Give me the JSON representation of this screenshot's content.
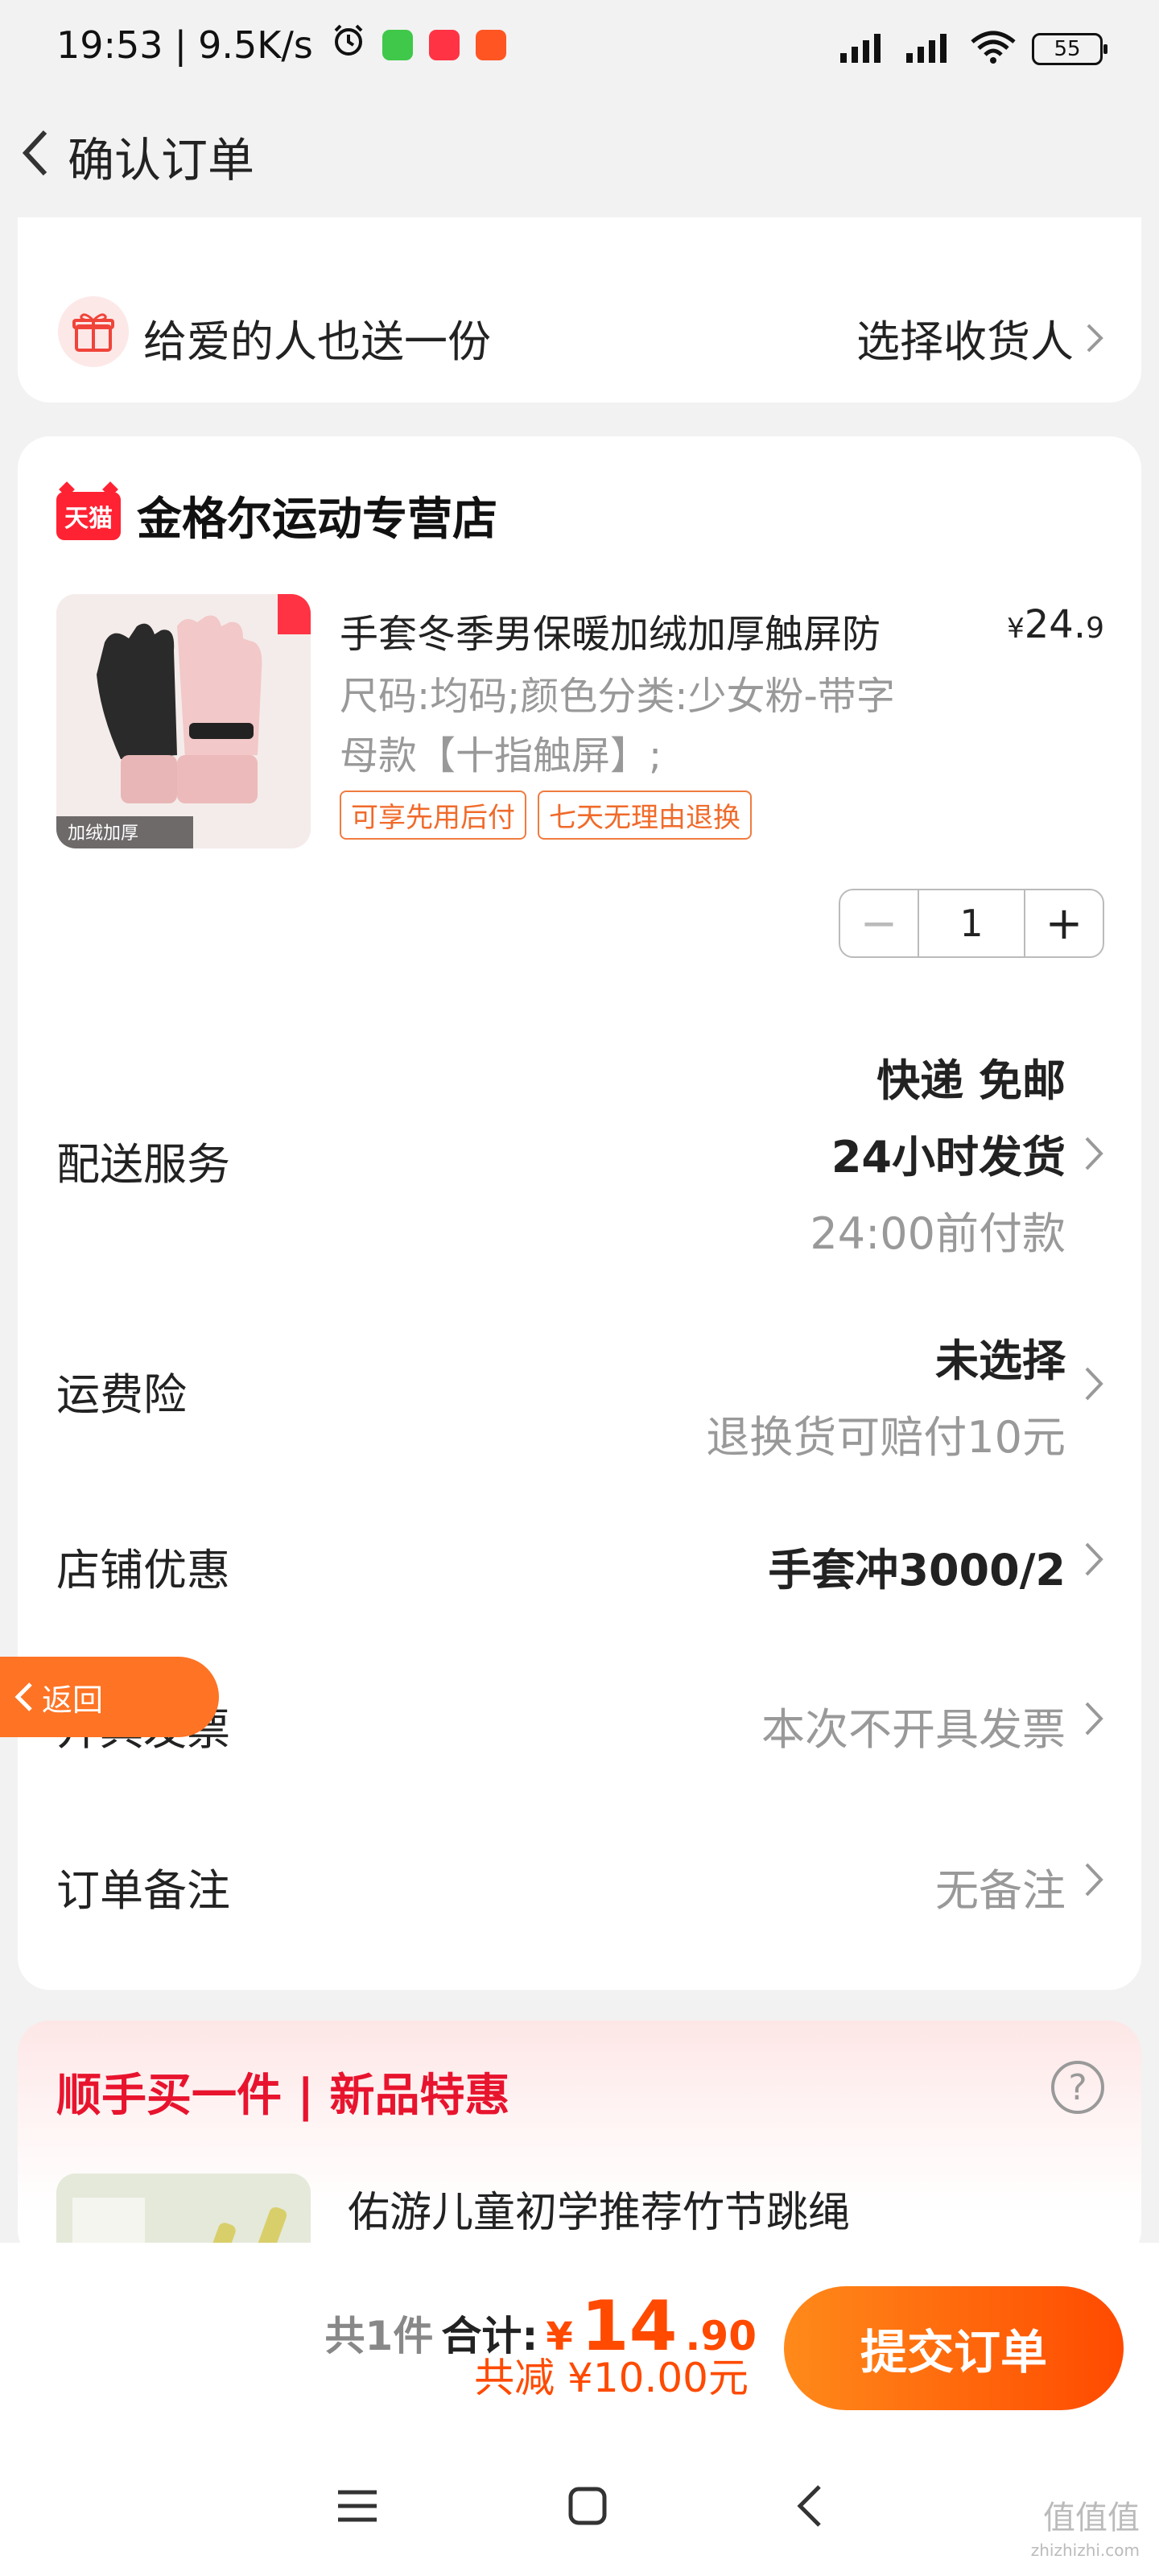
{
  "status_bar": {
    "time": "19:53",
    "speed": "9.5K/s",
    "battery": "55"
  },
  "nav": {
    "title": "确认订单"
  },
  "gift": {
    "text": "给爱的人也送一份",
    "action": "选择收货人"
  },
  "shop": {
    "logo_text": "天猫",
    "name": "金格尔运动专营店"
  },
  "product": {
    "title": "手套冬季男保暖加绒加厚触屏防",
    "price_symbol": "¥",
    "price_int": "24.",
    "price_dec": "9",
    "spec": "尺码:均码;颜色分类:少女粉-带字母款【十指触屏】;",
    "tags": [
      "可享先用后付",
      "七天无理由退换"
    ],
    "image_badge": "加绒加厚"
  },
  "quantity": {
    "minus": "−",
    "value": "1",
    "plus": "+"
  },
  "delivery": {
    "label": "配送服务",
    "line1": "快递 免邮",
    "line2": "24小时发货",
    "line3": "24:00前付款"
  },
  "insurance": {
    "label": "运费险",
    "line1": "未选择",
    "line2": "退换货可赔付10元"
  },
  "coupon": {
    "label": "店铺优惠",
    "value": "手套冲3000/2"
  },
  "invoice": {
    "label": "开具发票",
    "value": "本次不开具发票"
  },
  "note": {
    "label": "订单备注",
    "value": "无备注"
  },
  "float_back": {
    "label": "返回"
  },
  "recommend": {
    "title": "顺手买一件 | 新品特惠",
    "help": "?",
    "item_name": "佑游儿童初学推荐竹节跳绳"
  },
  "footer": {
    "count": "共1件",
    "sum_label": "合计:",
    "yen": "¥",
    "sum_int": "14",
    "sum_dec": ".90",
    "discount": "共减 ¥10.00元",
    "submit": "提交订单"
  },
  "watermark": {
    "main": "值值值",
    "sub": "zhizhizhi.com"
  },
  "colors": {
    "accent": "#ff4a00",
    "brand_red": "#e8142e",
    "tmall": "#ff2233"
  }
}
